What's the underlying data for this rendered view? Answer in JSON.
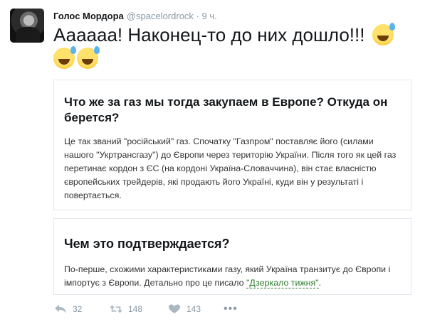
{
  "tweet": {
    "author_name": "Голос Мордора",
    "handle": "@spacelordrock",
    "separator": "·",
    "time": "9 ч.",
    "text": "Аааааа! Наконец-то до них дошло!!!",
    "emojis": [
      "sweat-smile-emoji",
      "sweat-smile-emoji",
      "sweat-smile-emoji"
    ]
  },
  "cards": [
    {
      "title": "Что же за газ мы тогда закупаем в Европе? Откуда он берется?",
      "body": "Це так званий \"російський\" газ. Спочатку \"Газпром\" поставляє його (силами нашого \"Укртрансгазу\") до Європи через територію України. Після того як цей газ перетинає кордон з ЄС (на кордоні Україна-Словаччина), він стає власністю європейських трейдерів, які продають його Україні, куди він у результаті і повертається."
    },
    {
      "title": "Чем это подтверждается?",
      "body_prefix": "По-перше, схожими характеристиками газу, який Україна транзитує до Європи і імпортує з Європи. Детально про це писало ",
      "link_text": "\"Дзеркало тижня\"",
      "body_suffix": "."
    }
  ],
  "actions": {
    "reply_count": "32",
    "retweet_count": "148",
    "like_count": "143",
    "more_label": "•••"
  },
  "icons": {
    "reply": "reply-icon",
    "retweet": "retweet-icon",
    "like": "heart-icon",
    "more": "more-icon"
  },
  "colors": {
    "muted": "#8899a6",
    "link": "#2a7a2a",
    "border": "#e1e8ed"
  }
}
